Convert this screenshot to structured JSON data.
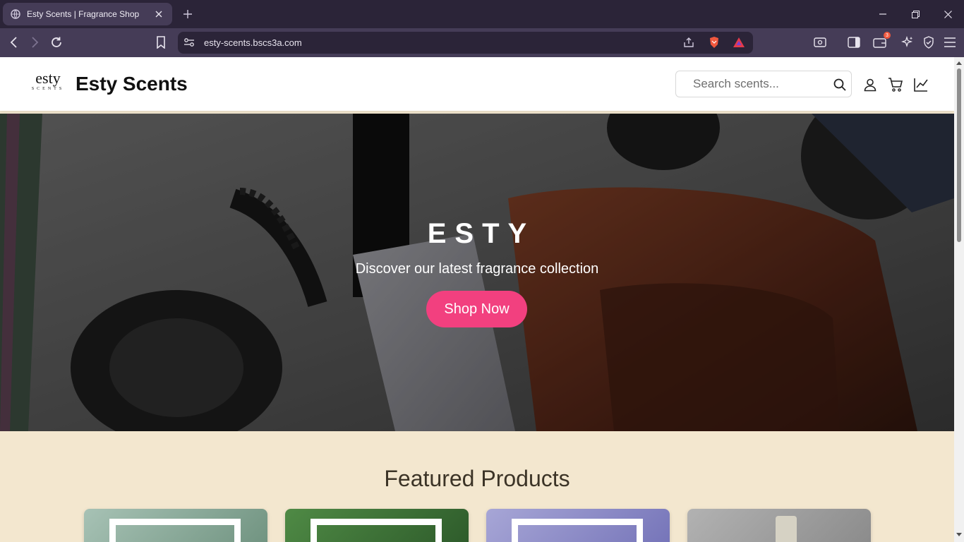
{
  "browser": {
    "tab_title": "Esty Scents | Fragrance Shop",
    "url": "esty-scents.bscs3a.com",
    "rewards_badge": "3"
  },
  "header": {
    "logo_main": "esty",
    "logo_sub": "SCENTS",
    "site_name": "Esty Scents",
    "search_placeholder": "Search scents..."
  },
  "hero": {
    "title": "ESTY",
    "subtitle": "Discover our latest fragrance collection",
    "cta_label": "Shop Now"
  },
  "featured": {
    "title": "Featured Products",
    "cards": [
      {
        "name": "product-card-1",
        "accent": "#8eb0a0"
      },
      {
        "name": "product-card-2",
        "accent": "#3f7a3a"
      },
      {
        "name": "product-card-3",
        "accent": "#8f8fc9"
      },
      {
        "name": "product-card-4",
        "accent": "#9a9a9a"
      }
    ]
  },
  "colors": {
    "accent_pink": "#f2407f",
    "page_bg": "#f3e7cf",
    "chrome_bg": "#2b2438"
  }
}
